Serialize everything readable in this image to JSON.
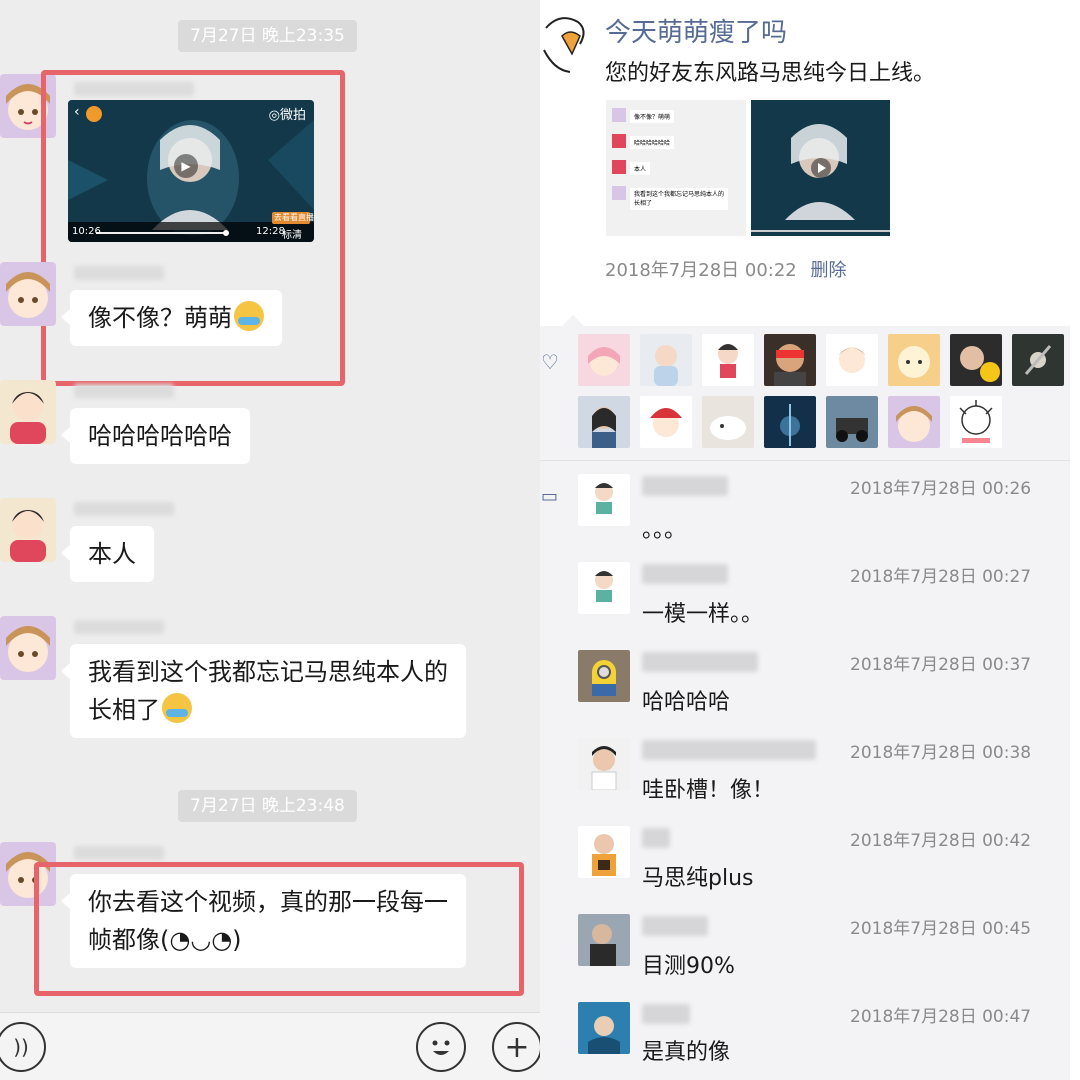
{
  "chat": {
    "time_1": "7月27日 晚上23:35",
    "time_2": "7月27日 晚上23:48",
    "messages": [
      {
        "text": "像不像？萌萌"
      },
      {
        "text": "哈哈哈哈哈哈"
      },
      {
        "text": "本人"
      },
      {
        "text_line1": "我看到这个我都忘记马思纯本人的",
        "text_line2": "长相了"
      },
      {
        "text_line1": "你去看这个视频，真的那一段每一",
        "text_line2": "帧都像(◔◡◔)"
      }
    ],
    "video": {
      "brand": "◎微拍",
      "time_start": "10:26",
      "time_end": "12:28",
      "quality": "标清",
      "tag": "去看看直播"
    }
  },
  "moment": {
    "user": "今天萌萌瘦了吗",
    "text": "您的好友东风路马思纯今日上线。",
    "date": "2018年7月28日 00:22",
    "delete_label": "删除",
    "thumb_chat_lines": [
      "像不像？萌萌",
      "哈哈哈哈哈哈",
      "本人",
      "我看到这个我都忘记马思纯本人的",
      "长相了"
    ],
    "comments": [
      {
        "time": "2018年7月28日 00:26",
        "text": "。。。"
      },
      {
        "time": "2018年7月28日 00:27",
        "text": "一模一样。。"
      },
      {
        "time": "2018年7月28日 00:37",
        "text": "哈哈哈哈"
      },
      {
        "time": "2018年7月28日 00:38",
        "text": "哇卧槽！像！"
      },
      {
        "time": "2018年7月28日 00:42",
        "text": "马思纯plus"
      },
      {
        "time": "2018年7月28日 00:45",
        "text": "目测90%"
      },
      {
        "time": "2018年7月28日 00:47",
        "text": "是真的像"
      }
    ]
  },
  "colors": {
    "highlight": "#e8646b",
    "link": "#576b95",
    "chat_bg": "#ededed"
  }
}
